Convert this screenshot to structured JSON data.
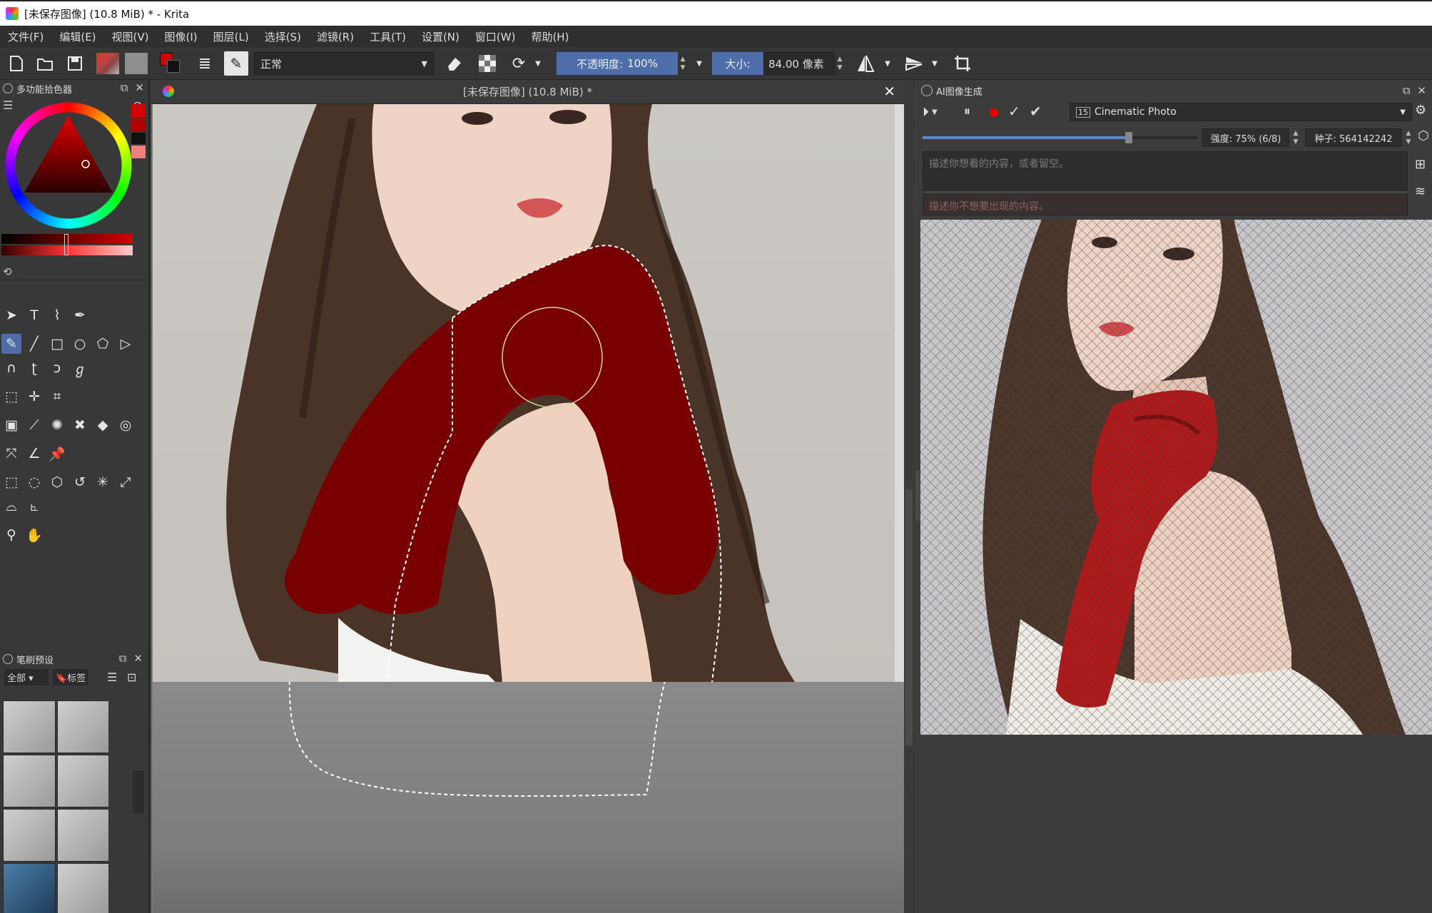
{
  "window": {
    "title": "[未保存图像] (10.8 MiB) * - Krita"
  },
  "menu": [
    "文件(F)",
    "编辑(E)",
    "视图(V)",
    "图像(I)",
    "图层(L)",
    "选择(S)",
    "滤镜(R)",
    "工具(T)",
    "设置(N)",
    "窗口(W)",
    "帮助(H)"
  ],
  "toolbar": {
    "blend_mode": "正常",
    "opacity_label": "不透明度:",
    "opacity_value": "100%",
    "size_label": "大小:",
    "size_value": "84.00 像素"
  },
  "left_docker": {
    "color_selector_title": "多功能拾色器",
    "brush_presets_title": "笔刷预设",
    "brush_filter": "全部",
    "brush_tag": "标签"
  },
  "canvas": {
    "tab_title": "[未保存图像] (10.8 MiB) *"
  },
  "ai_panel": {
    "title": "AI图像生成",
    "style": "Cinematic Photo",
    "strength": "强度: 75% (6/8)",
    "strength_fraction": 0.75,
    "seed": "种子: 564142242",
    "prompt_placeholder": "描述你想看的内容，或者留空。",
    "negative_placeholder": "描述你不想要出现的内容。"
  },
  "colors": {
    "accent": "#4d6ea8",
    "foreground_color": "#d40000",
    "selection_fill": "#780000",
    "preview_scarf": "#b01818"
  },
  "icons": [
    "krita-logo-icon",
    "new-document-icon",
    "open-folder-icon",
    "save-icon",
    "gradient-icon",
    "pattern-icon",
    "swap-colors-icon",
    "brush-settings-icon",
    "brush-preset-icon",
    "eraser-icon",
    "alpha-lock-icon",
    "reload-icon",
    "mirror-horizontal-icon",
    "mirror-vertical-icon",
    "crop-icon",
    "play-icon",
    "pause-icon",
    "record-icon",
    "check-icon",
    "apply-icon",
    "settings-icon"
  ]
}
